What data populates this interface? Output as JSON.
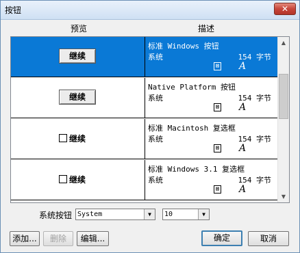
{
  "window": {
    "title": "按钮",
    "close_label": "✕"
  },
  "columns": {
    "preview": "预览",
    "description": "描述"
  },
  "rows": [
    {
      "preview_type": "button",
      "preview_label": "继续",
      "desc_title": "标准 Windows 按钮",
      "desc_type": "系统",
      "size": "154 字节",
      "selected": true
    },
    {
      "preview_type": "button",
      "preview_label": "继续",
      "desc_title": "Native Platform 按钮",
      "desc_type": "系统",
      "size": "154 字节",
      "selected": false
    },
    {
      "preview_type": "checkbox",
      "preview_label": "继续",
      "desc_title": "标准 Macintosh 复选框",
      "desc_type": "系统",
      "size": "154 字节",
      "selected": false
    },
    {
      "preview_type": "checkbox",
      "preview_label": "继续",
      "desc_title": "标准 Windows 3.1 复选框",
      "desc_type": "系统",
      "size": "154 字节",
      "selected": false
    }
  ],
  "icons": {
    "font": "font-file-icon",
    "truetype": "truetype-icon"
  },
  "system_button": {
    "label": "系统按钮",
    "font_value": "System",
    "size_value": "10"
  },
  "buttons": {
    "add": "添加...",
    "delete": "删除",
    "edit": "编辑...",
    "ok": "确定",
    "cancel": "取消"
  },
  "colors": {
    "selection": "#0a79d6",
    "close": "#c7463a"
  }
}
